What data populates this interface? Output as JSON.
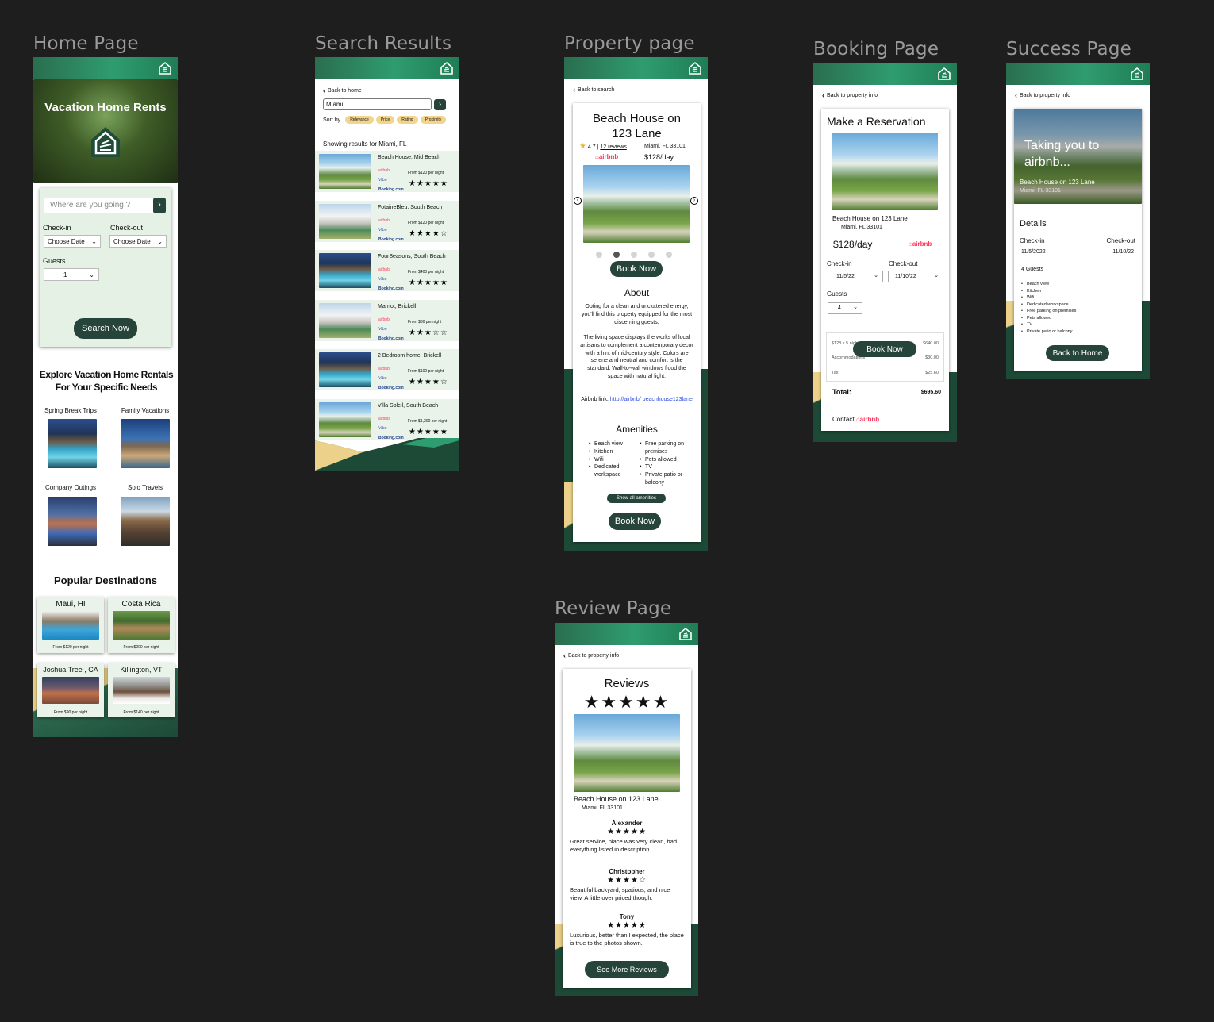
{
  "labels": {
    "home": "Home Page",
    "search": "Search Results",
    "property": "Property page",
    "booking": "Booking Page",
    "success": "Success Page",
    "review": "Review Page"
  },
  "colors": {
    "brand": "#27443a",
    "header_green": "#2f9c6f",
    "chip": "#f2d48b",
    "airbnb": "#ff385c",
    "sand": "#ecd18a"
  },
  "home": {
    "hero_title": "Vacation Home Rents",
    "search_placeholder": "Where are you going ?",
    "checkin_label": "Check-in",
    "checkout_label": "Check-out",
    "checkin_value": "Choose Date",
    "checkout_value": "Choose Date",
    "guests_label": "Guests",
    "guests_value": "1",
    "search_button": "Search Now",
    "explore_title": "Explore Vacation Home Rentals For Your Specific Needs",
    "categories": [
      "Spring Break Trips",
      "Family Vacations",
      "Company Outings",
      "Solo Travels"
    ],
    "popular_title": "Popular Destinations",
    "destinations": [
      {
        "name": "Maui, HI",
        "price": "From $120 per night"
      },
      {
        "name": "Costa Rica",
        "price": "From $200 per night"
      },
      {
        "name": "Joshua Tree , CA",
        "price": "From $90 per night"
      },
      {
        "name": "Killington, VT",
        "price": "From $140 per night"
      }
    ]
  },
  "search": {
    "back": "Back to home",
    "query": "Miami",
    "sort_label": "Sort by",
    "sort_options": [
      "Relevance",
      "Price",
      "Rating",
      "Proximity"
    ],
    "showing": "Showing results for Miami, FL",
    "providers": [
      "airbnb",
      "Vrbo",
      "Booking.com"
    ],
    "results": [
      {
        "name": "Beach House, Mid Beach",
        "price": "From $120 per night",
        "stars": "★★★★★"
      },
      {
        "name": "FotaineBleu, South Beach",
        "price": "From $120 per night",
        "stars": "★★★★☆"
      },
      {
        "name": "FourSeasons, South Beach",
        "price": "From $400 per night",
        "stars": "★★★★★"
      },
      {
        "name": "Marriot, Brickell",
        "price": "From $80 per night",
        "stars": "★★★☆☆"
      },
      {
        "name": "2 Bedroom home, Brickell",
        "price": "From $100 per night",
        "stars": "★★★★☆"
      },
      {
        "name": "Villa Soleil, South Beach",
        "price": "From $1,200 per night",
        "stars": "★★★★★"
      }
    ]
  },
  "property": {
    "back": "Back to search",
    "title": "Beach House on 123 Lane",
    "rating": "4.7",
    "reviews": "12 reviews",
    "location": "Miami, FL 33101",
    "provider": "airbnb",
    "price": "$128/day",
    "book": "Book Now",
    "about_title": "About",
    "about_1": "Opting for a clean and uncluttered energy, you'll find this property equipped for the most discerning guests.",
    "about_2": "The living space displays the works of local artisans to complement a contemporary decor with a hint of mid-century style. Colors are serene and neutral and comfort is the standard. Wall-to-wall windows flood the space with natural light.",
    "link_label": "Airbnb link:",
    "link": "http://airbnb/ beachhouse123lane",
    "amenities_title": "Amenities",
    "amenities_left": [
      "Beach view",
      "Kitchen",
      "Wifi",
      "Dedicated workspace"
    ],
    "amenities_right": [
      "Free parking on premises",
      "Pets allowed",
      "TV",
      "Private patio or balcony"
    ],
    "show_all": "Show all amenities"
  },
  "booking": {
    "back": "Back to property info",
    "title": "Make a Reservation",
    "name": "Beach House on 123 Lane",
    "location": "Miami, FL 33101",
    "price": "$128/day",
    "provider": "airbnb",
    "checkin_label": "Check-in",
    "checkout_label": "Check-out",
    "checkin": "11/5/22",
    "checkout": "11/10/22",
    "guests_label": "Guests",
    "guests": "4",
    "line1": "$128 x 5 nights",
    "line1_amt": "$640.00",
    "line2": "Accommodations",
    "line2_amt": "$30.00",
    "line3": "Tax",
    "line3_amt": "$25.60",
    "book": "Book Now",
    "total_label": "Total:",
    "total": "$695.60",
    "contact": "Contact"
  },
  "success": {
    "back": "Back to property info",
    "banner": "Taking you to airbnb...",
    "name": "Beach House on 123 Lane",
    "location": "Miami, FL 33101",
    "details": "Details",
    "checkin_label": "Check-in",
    "checkout_label": "Check-out",
    "checkin": "11/5/2022",
    "checkout": "11/10/22",
    "guests": "4 Guests",
    "amenities": [
      "Beach view",
      "Kitchen",
      "Wifi",
      "Dedicated workspace",
      "Free parking on premises",
      "Pets allowed",
      "TV",
      "Private patio or balcony"
    ],
    "home_button": "Back to Home"
  },
  "review": {
    "back": "Back to property info",
    "title": "Reviews",
    "overall": "★★★★★",
    "name": "Beach House on 123 Lane",
    "location": "Miami, FL 33101",
    "reviews": [
      {
        "author": "Alexander",
        "stars": "★★★★★",
        "text": "Great service, place was very clean, had everything listed in description."
      },
      {
        "author": "Christopher",
        "stars": "★★★★☆",
        "text": "Beautiful backyard, spatious, and nice view. A little over priced though."
      },
      {
        "author": "Tony",
        "stars": "★★★★★",
        "text": "Luxurious, better than I expected, the place is true to the photos shown."
      }
    ],
    "more": "See More Reviews"
  }
}
